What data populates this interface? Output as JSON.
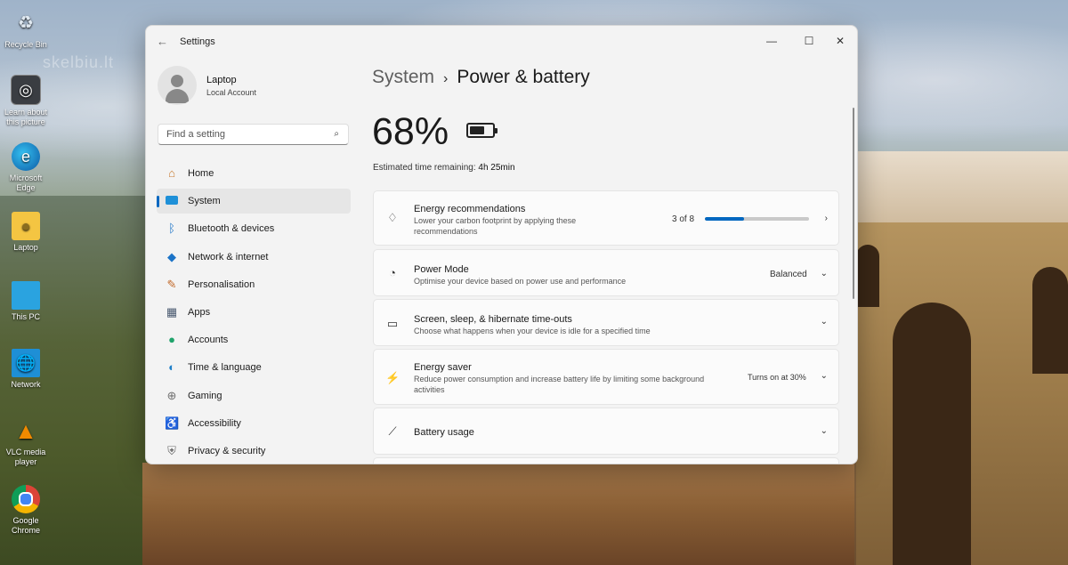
{
  "desktop": {
    "watermark": "skelbiu.lt",
    "icons": [
      {
        "label": "Recycle Bin",
        "icon": "recycle-bin-icon"
      },
      {
        "label": "Learn about this picture",
        "icon": "camera-icon"
      },
      {
        "label": "Microsoft Edge",
        "icon": "edge-icon"
      },
      {
        "label": "Laptop",
        "icon": "user-folder-icon"
      },
      {
        "label": "This PC",
        "icon": "monitor-icon"
      },
      {
        "label": "Network",
        "icon": "network-icon"
      },
      {
        "label": "VLC media player",
        "icon": "vlc-icon"
      },
      {
        "label": "Google Chrome",
        "icon": "chrome-icon"
      }
    ]
  },
  "window": {
    "title": "Settings",
    "controls": {
      "minimize": "—",
      "maximize": "☐",
      "close": "✕"
    }
  },
  "profile": {
    "name": "Laptop",
    "account_type": "Local Account"
  },
  "search": {
    "placeholder": "Find a setting",
    "value": ""
  },
  "sidebar": {
    "items": [
      {
        "label": "Home",
        "icon": "home-icon",
        "active": false
      },
      {
        "label": "System",
        "icon": "system-icon",
        "active": true
      },
      {
        "label": "Bluetooth & devices",
        "icon": "bluetooth-icon",
        "active": false
      },
      {
        "label": "Network & internet",
        "icon": "wifi-icon",
        "active": false
      },
      {
        "label": "Personalisation",
        "icon": "brush-icon",
        "active": false
      },
      {
        "label": "Apps",
        "icon": "apps-icon",
        "active": false
      },
      {
        "label": "Accounts",
        "icon": "accounts-icon",
        "active": false
      },
      {
        "label": "Time & language",
        "icon": "globe-clock-icon",
        "active": false
      },
      {
        "label": "Gaming",
        "icon": "gamepad-icon",
        "active": false
      },
      {
        "label": "Accessibility",
        "icon": "accessibility-icon",
        "active": false
      },
      {
        "label": "Privacy & security",
        "icon": "shield-icon",
        "active": false
      }
    ]
  },
  "breadcrumb": {
    "parent": "System",
    "separator": "›",
    "current": "Power & battery"
  },
  "battery": {
    "percent_label": "68%",
    "level": 0.68,
    "remaining_label": "Estimated time remaining:",
    "remaining_value": "4h 25min"
  },
  "cards": {
    "energy": {
      "title": "Energy recommendations",
      "desc": "Lower your carbon footprint by applying these recommendations",
      "count_label": "3 of 8",
      "progress": 0.375,
      "icon": "leaf-icon"
    },
    "power_mode": {
      "title": "Power Mode",
      "desc": "Optimise your device based on power use and performance",
      "value": "Balanced",
      "icon": "speedometer-icon"
    },
    "screen_sleep": {
      "title": "Screen, sleep, & hibernate time-outs",
      "desc": "Choose what happens when your device is idle for a specified time",
      "icon": "screen-sleep-icon"
    },
    "energy_saver": {
      "title": "Energy saver",
      "desc": "Reduce power consumption and increase battery life by limiting some background activities",
      "value": "Turns on at 30%",
      "icon": "energy-saver-icon"
    },
    "battery_usage": {
      "title": "Battery usage",
      "icon": "chart-line-icon"
    }
  },
  "colors": {
    "accent": "#0067c0",
    "window_bg": "#f3f3f3",
    "card_bg": "#fbfbfb"
  }
}
